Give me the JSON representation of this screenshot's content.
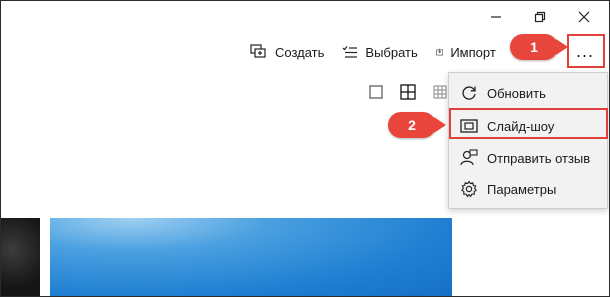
{
  "window_controls": {
    "minimize": "minimize-icon",
    "maximize": "restore-icon",
    "close": "close-icon"
  },
  "toolbar": {
    "create_label": "Создать",
    "select_label": "Выбрать",
    "import_label": "Импорт",
    "more_label": "..."
  },
  "view_toggles": [
    "single-view-icon",
    "grid-view-icon",
    "small-grid-view-icon"
  ],
  "menu": {
    "items": [
      {
        "label": "Обновить",
        "icon": "refresh-icon"
      },
      {
        "label": "Слайд-шоу",
        "icon": "slideshow-icon"
      },
      {
        "label": "Отправить отзыв",
        "icon": "feedback-icon"
      },
      {
        "label": "Параметры",
        "icon": "gear-icon"
      }
    ]
  },
  "callouts": {
    "first": "1",
    "second": "2"
  },
  "colors": {
    "accent": "#e1413b",
    "menu_bg": "#f2f2f2"
  }
}
